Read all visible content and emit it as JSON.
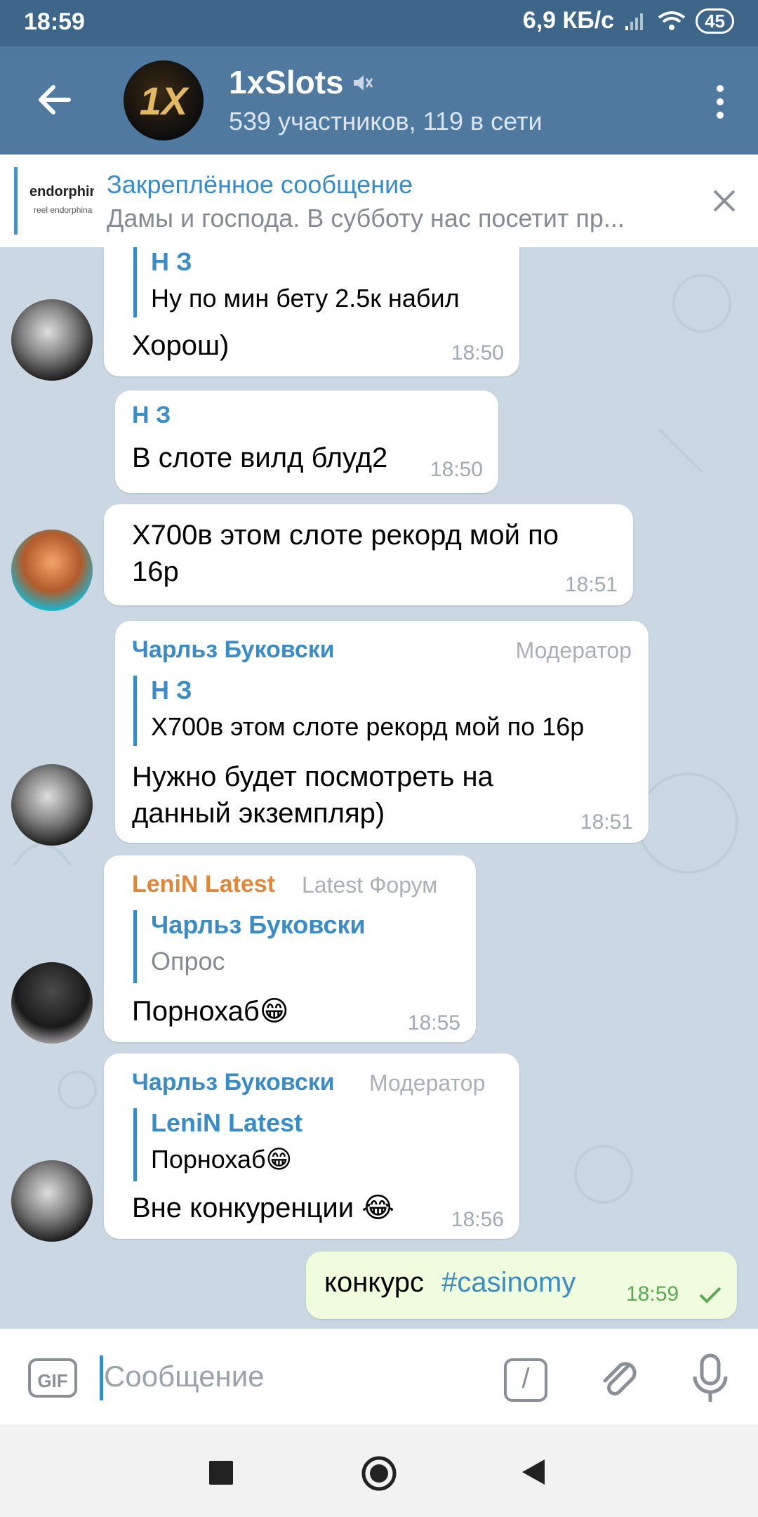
{
  "status_bar": {
    "time": "18:59",
    "speed": "6,9 КБ/с",
    "battery": "45"
  },
  "header": {
    "title": "1xSlots",
    "subtitle": "539 участников, 119 в сети",
    "avatar_text": "1X"
  },
  "pinned": {
    "title": "Закреплённое сообщение",
    "text": "Дамы и господа.  В субботу нас посетит пр...",
    "thumb_text": "endorphina",
    "thumb_sub": "reel endorphina"
  },
  "messages": [
    {
      "quote_name": "Н З",
      "quote_text": "Ну по мин бету 2.5к набил",
      "text": "Хорош)",
      "time": "18:50"
    },
    {
      "sender": "Н З",
      "text": "В слоте вилд блуд2",
      "time": "18:50"
    },
    {
      "text_line1": "X700в этом слоте рекорд мой по",
      "text_line2": "16р",
      "time": "18:51"
    },
    {
      "sender": "Чарльз Буковски",
      "role": "Модератор",
      "quote_name": "Н З",
      "quote_text": "X700в этом слоте рекорд мой по 16р",
      "text_line1": "Нужно будет посмотреть на",
      "text_line2": "данный экземпляр)",
      "time": "18:51"
    },
    {
      "sender": "LeniN Latest",
      "role": "Latest Форум",
      "quote_name": "Чарльз Буковски",
      "quote_text": "Опрос",
      "text": "Порнохаб😁",
      "time": "18:55"
    },
    {
      "sender": "Чарльз Буковски",
      "role": "Модератор",
      "quote_name": "LeniN Latest",
      "quote_text": "Порнохаб😁",
      "text": "Вне конкуренции 😂",
      "time": "18:56"
    },
    {
      "text": "конкурс",
      "hashtag": "#casinomy",
      "time": "18:59"
    }
  ],
  "input": {
    "placeholder": "Сообщение",
    "gif_label": "GIF"
  },
  "colors": {
    "header": "#5079a0",
    "status_bar": "#3d6688",
    "accent": "#3a8cc7",
    "lenin": "#e0883a",
    "out_bubble": "#effdde"
  }
}
